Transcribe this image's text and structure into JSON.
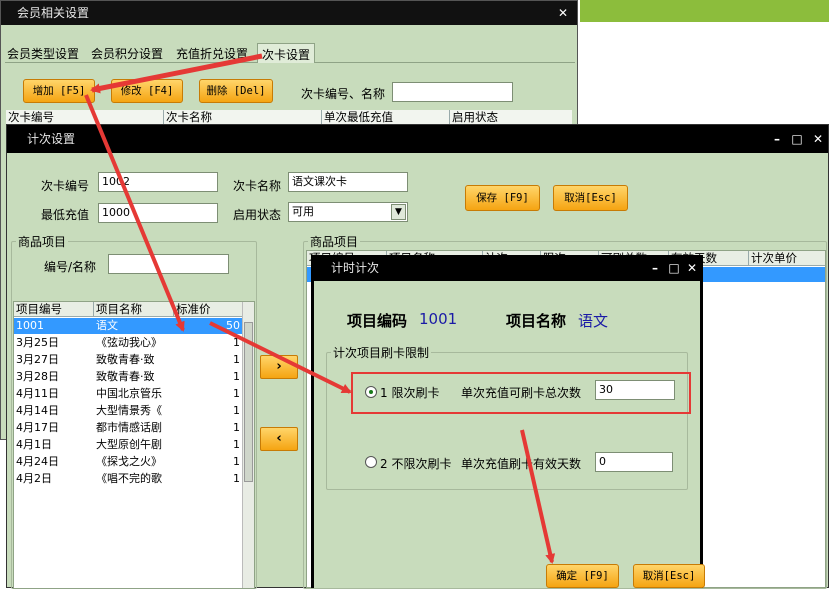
{
  "background_window": {
    "title": "会员相关设置",
    "close_glyph": "✕",
    "tabs": [
      "会员类型设置",
      "会员积分设置",
      "充值折兑设置",
      "次卡设置"
    ],
    "add_label": "增加 [F5]",
    "edit_label": "修改 [F4]",
    "delete_label": "删除 [Del]",
    "search_label": "次卡编号、名称",
    "search_value": "",
    "columns": [
      "次卡编号",
      "次卡名称",
      "单次最低充值",
      "启用状态"
    ]
  },
  "count_window": {
    "title": "计次设置",
    "min_glyph": "–",
    "max_glyph": "□",
    "close_glyph": "✕",
    "card_no_label": "次卡编号",
    "card_no_value": "1002",
    "card_name_label": "次卡名称",
    "card_name_value": "语文课次卡",
    "min_charge_label": "最低充值",
    "min_charge_value": "1000",
    "status_label": "启用状态",
    "status_value": "可用",
    "save_label": "保存 [F9]",
    "cancel_label": "取消[Esc]",
    "left_group_title": "商品项目",
    "code_name_label": "编号/名称",
    "code_name_value": "",
    "left_columns": [
      "项目编号",
      "项目名称",
      "标准价"
    ],
    "items": [
      {
        "code": "1001",
        "name": "语文",
        "price": "50"
      },
      {
        "code": "3月25日",
        "name": "《弦动我心》",
        "price": "1"
      },
      {
        "code": "3月27日",
        "name": "致敬青春·致",
        "price": "1"
      },
      {
        "code": "3月28日",
        "name": "致敬青春·致",
        "price": "1"
      },
      {
        "code": "4月11日",
        "name": "中国北京管乐",
        "price": "1"
      },
      {
        "code": "4月14日",
        "name": "大型情景秀《",
        "price": "1"
      },
      {
        "code": "4月17日",
        "name": "都市情感话剧",
        "price": "1"
      },
      {
        "code": "4月1日",
        "name": "大型原创午剧",
        "price": "1"
      },
      {
        "code": "4月24日",
        "name": "《探戈之火》",
        "price": "1"
      },
      {
        "code": "4月2日",
        "name": "《唱不完的歌",
        "price": "1"
      }
    ],
    "move_right_glyph": "›",
    "move_left_glyph": "‹",
    "right_group_title": "商品项目",
    "right_columns": [
      "项目编号",
      "项目名称",
      "计次",
      "限次",
      "可刷总数",
      "有效天数",
      "计次单价"
    ]
  },
  "timing_dialog": {
    "title": "计时计次",
    "min_glyph": "–",
    "max_glyph": "□",
    "close_glyph": "✕",
    "code_label": "项目编码",
    "code_value": "1001",
    "name_label": "项目名称",
    "name_value": "语文",
    "group_title": "计次项目刷卡限制",
    "option1_label": "1 限次刷卡",
    "option1_field_label": "单次充值可刷卡总次数",
    "option1_value": "30",
    "option2_label": "2 不限次刷卡",
    "option2_field_label": "单次充值刷卡有效天数",
    "option2_value": "0",
    "ok_label": "确定 [F9]",
    "cancel_label": "取消[Esc]"
  },
  "colors": {
    "titlebar": "#000000",
    "window_bg": "#c8dcbc",
    "button_orange": "#f5a412",
    "highlight_red": "#e53935",
    "selection_blue": "#3399ff",
    "value_blue": "#1a1aa6"
  }
}
